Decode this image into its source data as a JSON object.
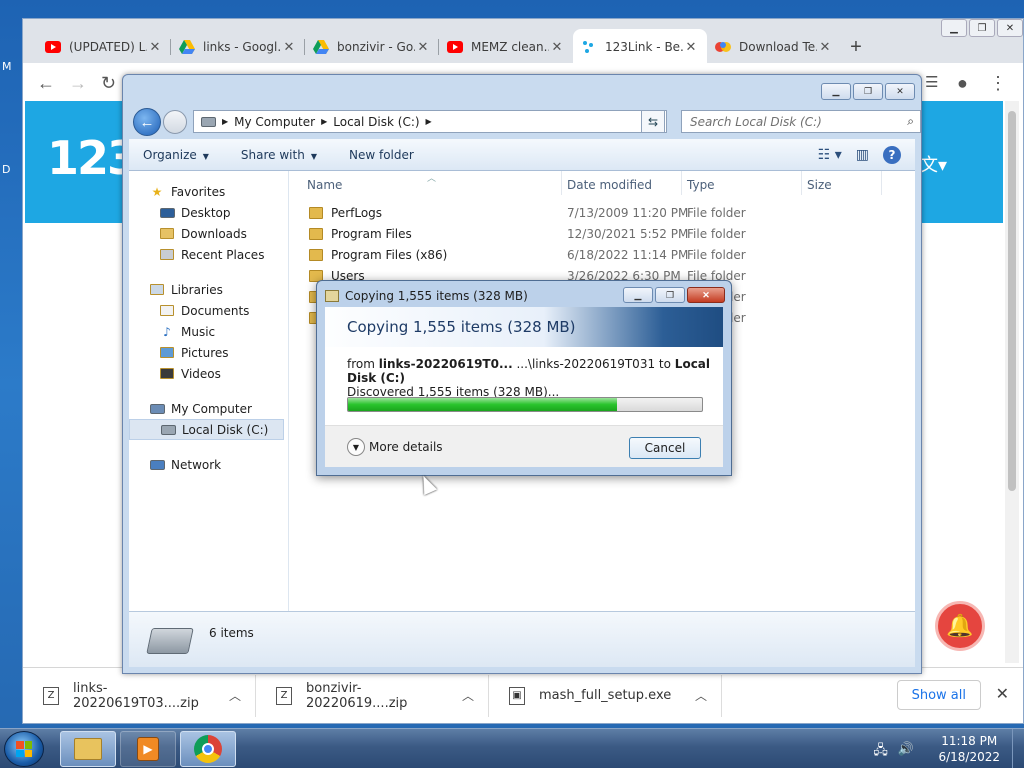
{
  "desktop": {
    "letters": [
      "M",
      "D"
    ]
  },
  "chrome": {
    "tabs": [
      {
        "title": "(UPDATED) L...",
        "favicon": "youtube-icon",
        "active": false
      },
      {
        "title": "links - Googl...",
        "favicon": "google-drive-icon",
        "active": false
      },
      {
        "title": "bonzivir - Go...",
        "favicon": "google-drive-icon",
        "active": false
      },
      {
        "title": "MEMZ clean...",
        "favicon": "youtube-icon",
        "active": false
      },
      {
        "title": "123Link - Be...",
        "favicon": "123link-icon",
        "active": true
      },
      {
        "title": "Download Te...",
        "favicon": "colorful-icon",
        "active": false
      }
    ],
    "page_logo": "123",
    "downloads": [
      {
        "name": "links-20220619T03....zip"
      },
      {
        "name": "bonzivir-20220619....zip"
      },
      {
        "name": "mash_full_setup.exe"
      }
    ],
    "show_all_label": "Show all"
  },
  "explorer": {
    "breadcrumb": [
      "My Computer",
      "Local Disk (C:)"
    ],
    "search_placeholder": "Search Local Disk (C:)",
    "commands": {
      "organize": "Organize",
      "share_with": "Share with",
      "new_folder": "New folder"
    },
    "nav": {
      "favorites": {
        "label": "Favorites",
        "items": [
          "Desktop",
          "Downloads",
          "Recent Places"
        ]
      },
      "libraries": {
        "label": "Libraries",
        "items": [
          "Documents",
          "Music",
          "Pictures",
          "Videos"
        ]
      },
      "computer": {
        "label": "My Computer",
        "items": [
          "Local Disk (C:)"
        ]
      },
      "network": {
        "label": "Network"
      }
    },
    "columns": {
      "name": "Name",
      "date": "Date modified",
      "type": "Type",
      "size": "Size"
    },
    "files": [
      {
        "name": "PerfLogs",
        "date": "7/13/2009 11:20 PM",
        "type": "File folder"
      },
      {
        "name": "Program Files",
        "date": "12/30/2021 5:52 PM",
        "type": "File folder"
      },
      {
        "name": "Program Files (x86)",
        "date": "6/18/2022 11:14 PM",
        "type": "File folder"
      },
      {
        "name": "Users",
        "date": "3/26/2022 6:30 PM",
        "type": "File folder"
      },
      {
        "name": "",
        "date": "",
        "type": "File folder"
      },
      {
        "name": "",
        "date": "",
        "type": "File folder"
      }
    ],
    "item_count": "6 items"
  },
  "copy_dialog": {
    "title": "Copying 1,555 items (328 MB)",
    "header": "Copying 1,555 items (328 MB)",
    "from_label": "from",
    "from_source": "links-20220619T0...",
    "from_path": "...\\links-20220619T031",
    "to_label": "to",
    "to_dest": "Local Disk (C:)",
    "discovered": "Discovered 1,555 items (328 MB)...",
    "progress": 0.76,
    "more_details": "More details",
    "cancel": "Cancel"
  },
  "taskbar": {
    "time": "11:18 PM",
    "date": "6/18/2022"
  }
}
